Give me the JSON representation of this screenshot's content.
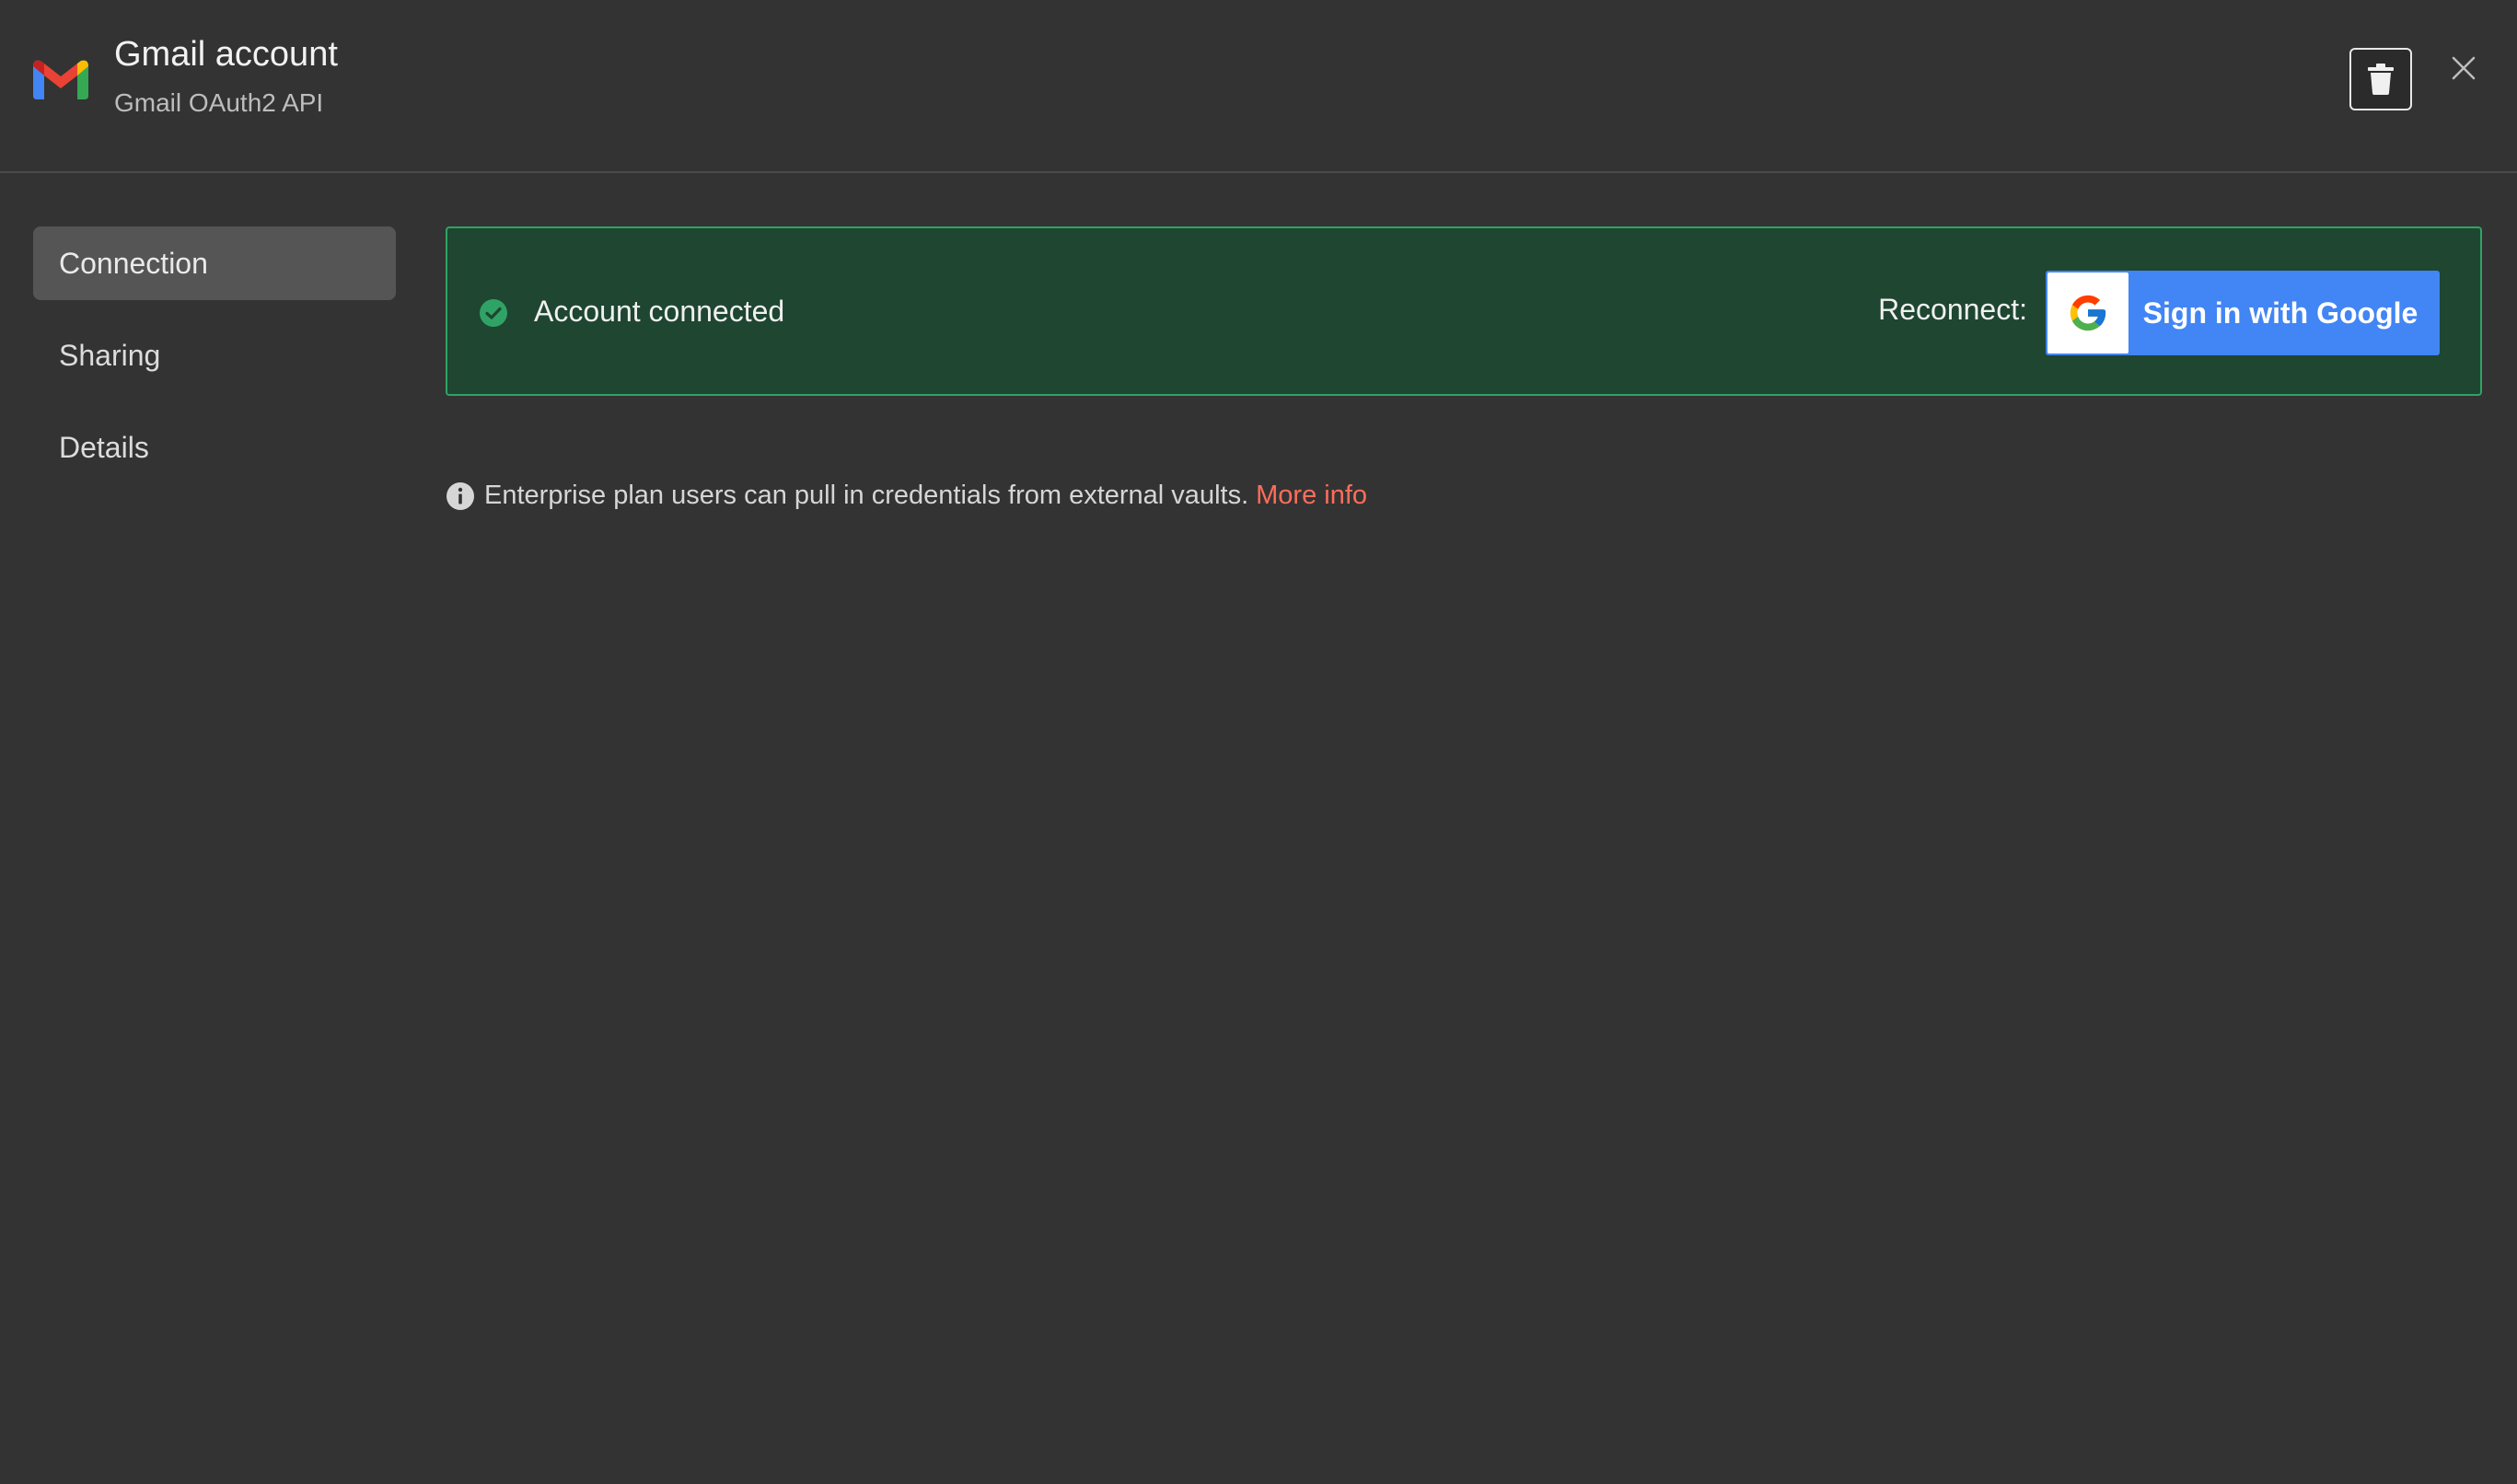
{
  "header": {
    "title": "Gmail account",
    "subtitle": "Gmail OAuth2 API",
    "logo_icon": "gmail-logo",
    "delete_icon": "trash-icon",
    "close_icon": "close-icon"
  },
  "sidebar": {
    "items": [
      {
        "label": "Connection",
        "active": true
      },
      {
        "label": "Sharing",
        "active": false
      },
      {
        "label": "Details",
        "active": false
      }
    ]
  },
  "status": {
    "text": "Account connected",
    "reconnect_label": "Reconnect:",
    "google_button_label": "Sign in with Google",
    "panel_color": "#1e4631",
    "border_color": "#2fa365"
  },
  "info": {
    "text": "Enterprise plan users can pull in credentials from external vaults.",
    "link_text": "More info",
    "link_color": "#ff6d5a"
  }
}
